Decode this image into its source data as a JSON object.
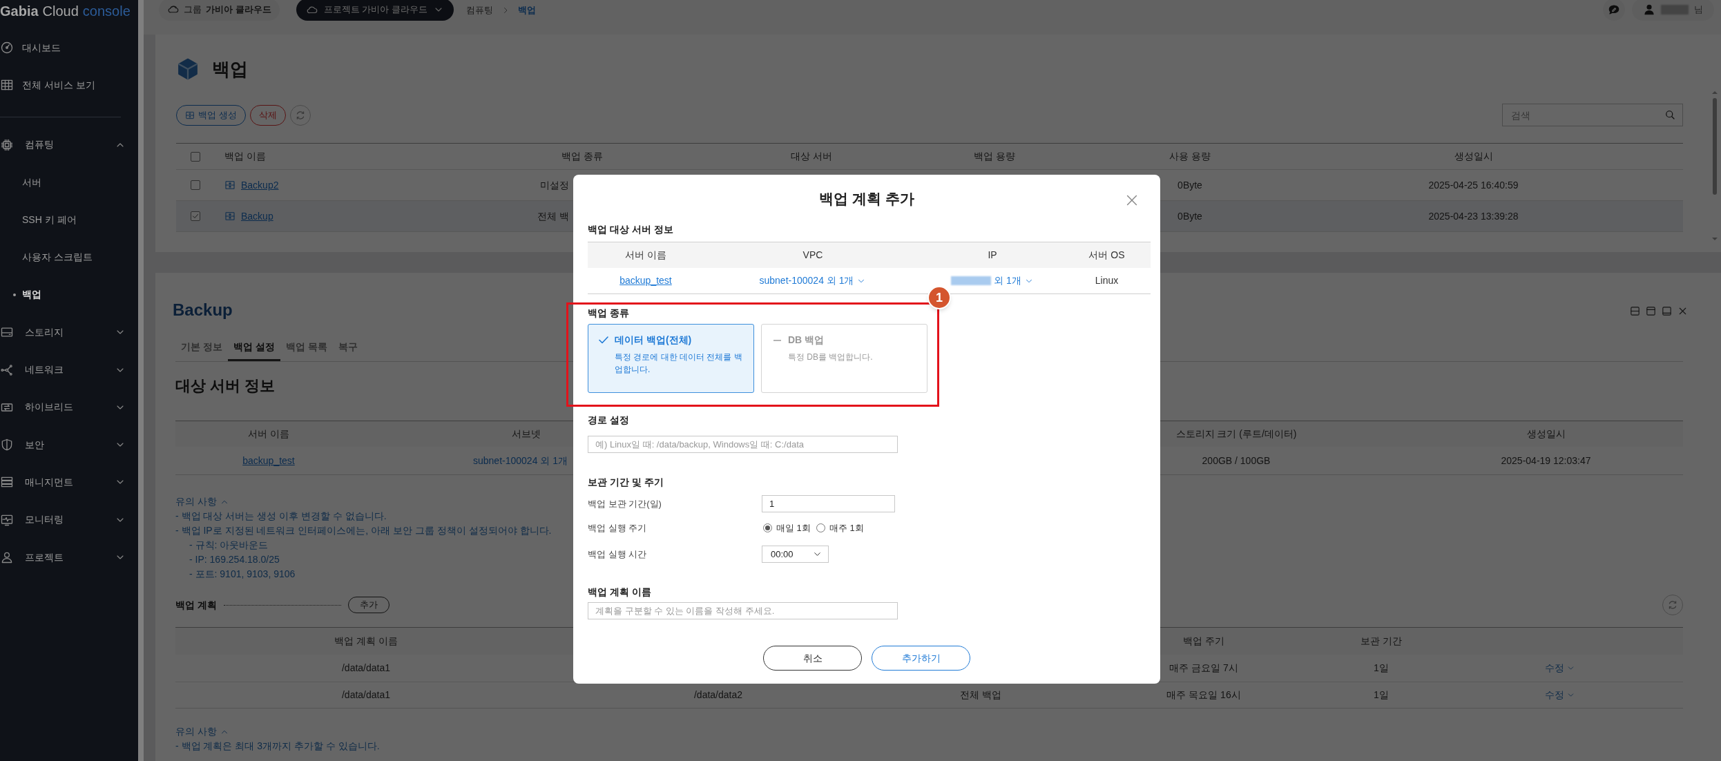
{
  "sidebar": {
    "logo": {
      "brand": "Gabia",
      "product": "Cloud",
      "suffix": "console"
    },
    "items": [
      {
        "kind": "link",
        "label": "대시보드"
      },
      {
        "kind": "link",
        "label": "전체 서비스 보기"
      },
      {
        "kind": "group",
        "label": "컴퓨팅",
        "expanded": true,
        "children": [
          {
            "label": "서버",
            "selected": false
          },
          {
            "label": "SSH 키 페어",
            "selected": false
          },
          {
            "label": "사용자 스크립트",
            "selected": false
          },
          {
            "label": "백업",
            "selected": true
          }
        ]
      },
      {
        "kind": "group",
        "label": "스토리지",
        "expanded": false
      },
      {
        "kind": "group",
        "label": "네트워크",
        "expanded": false
      },
      {
        "kind": "group",
        "label": "하이브리드",
        "expanded": false
      },
      {
        "kind": "group",
        "label": "보안",
        "expanded": false
      },
      {
        "kind": "group",
        "label": "매니지먼트",
        "expanded": false
      },
      {
        "kind": "group",
        "label": "모니터링",
        "expanded": false
      },
      {
        "kind": "group",
        "label": "프로젝트",
        "expanded": false
      }
    ]
  },
  "header": {
    "group": {
      "label": "그룹",
      "value": "가비아 클라우드"
    },
    "project": {
      "label": "프로젝트 가비아 클라우드"
    },
    "breadcrumb": [
      {
        "label": "컴퓨팅",
        "current": false
      },
      {
        "label": "백업",
        "current": true
      }
    ],
    "user": {
      "name_redacted": true,
      "suffix": "님"
    }
  },
  "backup_list": {
    "title": "백업",
    "actions": [
      {
        "kind": "create",
        "label": "백업 생성"
      },
      {
        "kind": "delete",
        "label": "삭제"
      },
      {
        "kind": "refresh"
      }
    ],
    "search": {
      "placeholder": "검색"
    },
    "columns": [
      null,
      "백업 이름",
      "백업 종류",
      "대상 서버",
      "백업 용량",
      "사용 용량",
      "생성일시"
    ],
    "all_checked": false,
    "rows": [
      {
        "selected": false,
        "name": "Backup2",
        "cells": [
          "미설정",
          null,
          null,
          "0Byte",
          "2025-04-25 16:40:59"
        ]
      },
      {
        "selected": true,
        "name": "Backup",
        "cells": [
          "전체 백",
          null,
          null,
          "0Byte",
          "2025-04-23 13:39:28"
        ]
      }
    ]
  },
  "detail": {
    "title": "Backup",
    "tabs": [
      {
        "label": "기본 정보",
        "selected": false
      },
      {
        "label": "백업 설정",
        "selected": true
      },
      {
        "label": "백업 목록",
        "selected": false
      },
      {
        "label": "복구",
        "selected": false
      }
    ],
    "server_info": {
      "title": "대상 서버 정보",
      "columns": [
        "서버 이름",
        "서브넷",
        null,
        "스토리지 크기 (루트/데이터)",
        null,
        "생성일시"
      ],
      "rows": [
        [
          "backup_test",
          "subnet-100024 외 1개",
          null,
          "200GB / 100GB",
          null,
          "2025-04-19 12:03:47"
        ]
      ]
    },
    "notes": {
      "title": "유의 사항",
      "expanded": true,
      "lines": [
        {
          "text": "- 백업 대상 서버는 생성 이후 변경할 수 없습니다."
        },
        {
          "text": "- 백업 IP로 지정된 네트워크 인터페이스에는, 아래 보안 그룹 정책이 설정되어야 합니다.",
          "children": [
            {
              "text": "- 규칙: 아웃바운드"
            },
            {
              "text": "- IP: 169.254.18.0/25"
            },
            {
              "text": "- 포트: 9101, 9103, 9106"
            }
          ]
        }
      ]
    },
    "plans": {
      "title": "백업 계획",
      "add_button": "추가",
      "columns": [
        "백업 계획 이름",
        null,
        null,
        "백업 주기",
        "보관 기간",
        null
      ],
      "rows": [
        [
          "/data/data1",
          null,
          null,
          "매주 금요일 7시",
          "1일",
          "수정"
        ],
        [
          "/data/data1",
          "/data/data2",
          "전체 백업",
          "매주 목요일 16시",
          "1일",
          "수정"
        ]
      ]
    },
    "plan_notes": {
      "title": "유의 사항",
      "expanded": true,
      "lines": [
        {
          "text": "- 백업 계획은 최대 3개까지 추가할 수 있습니다."
        }
      ]
    }
  },
  "modal": {
    "title": "백업 계획 추가",
    "server_section": {
      "title": "백업 대상 서버 정보",
      "columns": [
        "서버 이름",
        "VPC",
        "IP",
        "서버 OS"
      ],
      "row": [
        {
          "kind": "link",
          "text": "backup_test"
        },
        {
          "kind": "dropdown",
          "text": "subnet-100024 외 1개"
        },
        {
          "kind": "dropdown",
          "redacted": true,
          "text": "외 1개"
        },
        {
          "kind": "text",
          "text": "Linux"
        }
      ]
    },
    "backup_type": {
      "title": "백업 종류",
      "options": [
        {
          "label": "데이터 백업(전체)",
          "description": "특정 경로에 대한 데이터 전체를 백업합니다.",
          "selected": true
        },
        {
          "label": "DB 백업",
          "description": "특정 DB를 백업합니다.",
          "selected": false
        }
      ]
    },
    "path": {
      "title": "경로 설정",
      "placeholder": "예) Linux일 때: /data/backup, Windows일 때: C:/data"
    },
    "schedule": {
      "title": "보관 기간 및 주기",
      "fields": [
        {
          "kind": "input",
          "label": "백업 보관 기간(일)",
          "value": "1"
        },
        {
          "kind": "radio",
          "label": "백업 실행 주기",
          "options": [
            {
              "label": "매일 1회",
              "selected": true
            },
            {
              "label": "매주 1회",
              "selected": false
            }
          ]
        },
        {
          "kind": "select",
          "label": "백업 실행 시간",
          "value": "00:00"
        }
      ]
    },
    "plan_name": {
      "title": "백업 계획 이름",
      "placeholder": "계획을 구분할 수 있는 이름을 작성해 주세요."
    },
    "buttons": [
      {
        "kind": "cancel",
        "label": "취소"
      },
      {
        "kind": "primary",
        "label": "추가하기"
      }
    ]
  },
  "annotation": {
    "number": "1"
  }
}
